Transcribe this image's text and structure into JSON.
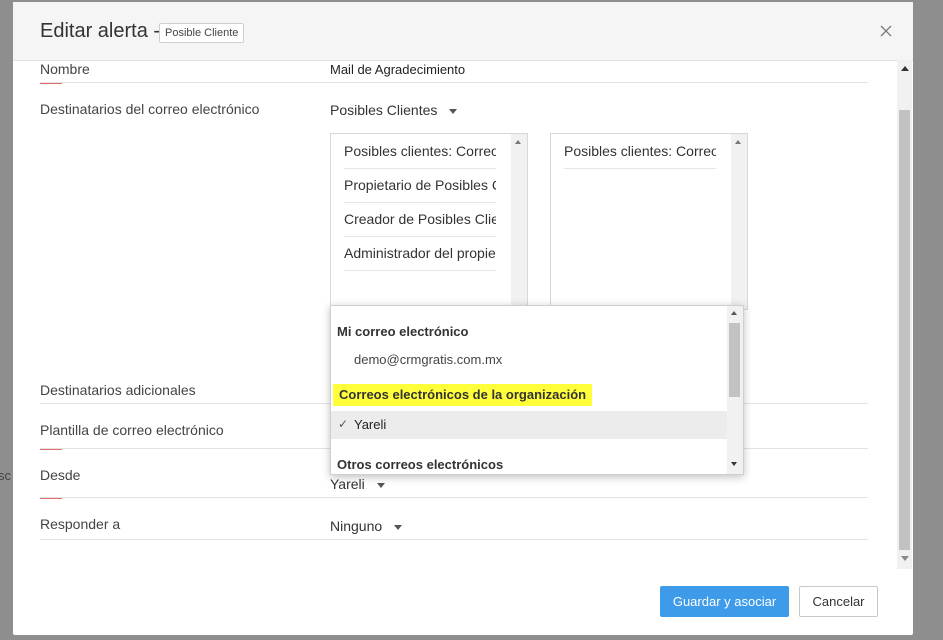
{
  "backdrop": {
    "partial_text": "sc"
  },
  "header": {
    "title": "Editar alerta -",
    "module_badge": "Posible Cliente"
  },
  "form": {
    "nombre": {
      "label": "Nombre",
      "value": "Mail de Agradecimiento"
    },
    "destinatarios": {
      "label": "Destinatarios del correo electrónico",
      "module_select": "Posibles Clientes",
      "available": [
        "Posibles clientes: Correo electrónico",
        "Propietario de Posibles Clientes",
        "Creador de Posibles Clientes",
        "Administrador del propietario"
      ],
      "selected": [
        "Posibles clientes: Correo electrónico"
      ]
    },
    "adicionales": {
      "label": "Destinatarios adicionales"
    },
    "plantilla": {
      "label": "Plantilla de correo electrónico"
    },
    "desde": {
      "label": "Desde",
      "value": "Yareli"
    },
    "responder": {
      "label": "Responder a",
      "value": "Ninguno"
    }
  },
  "dropdown": {
    "groups": [
      {
        "label": "Mi correo electrónico",
        "options": [
          "demo@crmgratis.com.mx"
        ]
      },
      {
        "label": "Correos electrónicos de la organización",
        "options": [
          "Yareli"
        ],
        "selected": "Yareli",
        "highlight_color": "#ffff3a"
      },
      {
        "label": "Otros correos electrónicos",
        "options": []
      }
    ],
    "check_mark": "✓"
  },
  "buttons": {
    "save": "Guardar y asociar",
    "cancel": "Cancelar"
  },
  "colors": {
    "primary": "#3d9be9",
    "required_marker": "#e26d6d",
    "overlay": "#8e8e8e"
  }
}
